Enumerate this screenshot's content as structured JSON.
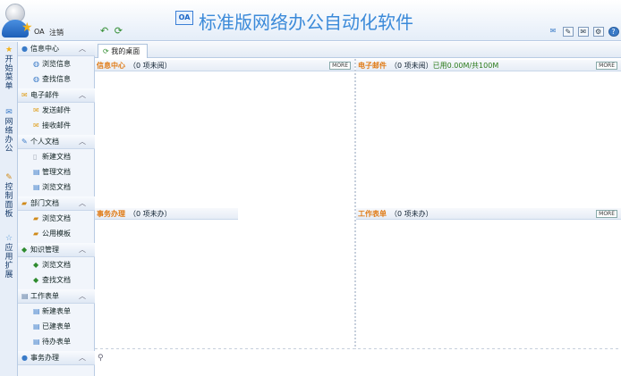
{
  "header": {
    "user": "OA",
    "logout": "注销",
    "title": "标准版网络办公自动化软件",
    "logo": "OA",
    "tools": [
      "back-icon",
      "refresh-icon"
    ],
    "tool_icons": [
      "chat-icon",
      "edit-icon",
      "mail-icon",
      "settings-icon",
      "help-icon"
    ]
  },
  "vtabs": [
    {
      "label": "开始菜单",
      "icon": "star-icon"
    },
    {
      "label": "网络办公",
      "icon": "mail-icon"
    },
    {
      "label": "控制面板",
      "icon": "wrench-icon"
    },
    {
      "label": "应用扩展",
      "icon": "star-icon"
    }
  ],
  "tree": [
    {
      "type": "group",
      "label": "信息中心"
    },
    {
      "type": "item",
      "label": "浏览信息"
    },
    {
      "type": "item",
      "label": "查找信息"
    },
    {
      "type": "group",
      "label": "电子邮件"
    },
    {
      "type": "item",
      "label": "发送邮件"
    },
    {
      "type": "item",
      "label": "接收邮件"
    },
    {
      "type": "group",
      "label": "个人文档"
    },
    {
      "type": "item",
      "label": "新建文档"
    },
    {
      "type": "item",
      "label": "管理文档"
    },
    {
      "type": "item",
      "label": "浏览文档"
    },
    {
      "type": "group",
      "label": "部门文档"
    },
    {
      "type": "item",
      "label": "浏览文档"
    },
    {
      "type": "item",
      "label": "公用模板"
    },
    {
      "type": "group",
      "label": "知识管理"
    },
    {
      "type": "item",
      "label": "浏览文档"
    },
    {
      "type": "item",
      "label": "查找文档"
    },
    {
      "type": "group",
      "label": "工作表单"
    },
    {
      "type": "item",
      "label": "新建表单"
    },
    {
      "type": "item",
      "label": "已建表单"
    },
    {
      "type": "item",
      "label": "待办表单"
    },
    {
      "type": "group",
      "label": "事务办理"
    }
  ],
  "tab": {
    "label": "我的桌面"
  },
  "panels": {
    "info": {
      "title": "信息中心",
      "count": "（0 项未阅）",
      "more": "MORE"
    },
    "mail": {
      "title": "电子邮件",
      "count": "（0 项未阅）",
      "extra": "已用0.00M/共100M",
      "more": "MORE"
    },
    "affairs": {
      "title": "事务办理",
      "count": "（0 项未办）"
    },
    "forms": {
      "title": "工作表单",
      "count": "（0 项未办）",
      "more": "MORE"
    }
  },
  "colors": {
    "accent": "#3b8ad9",
    "panel_title": "#e07a14",
    "header_bg": "#e4edf8"
  }
}
